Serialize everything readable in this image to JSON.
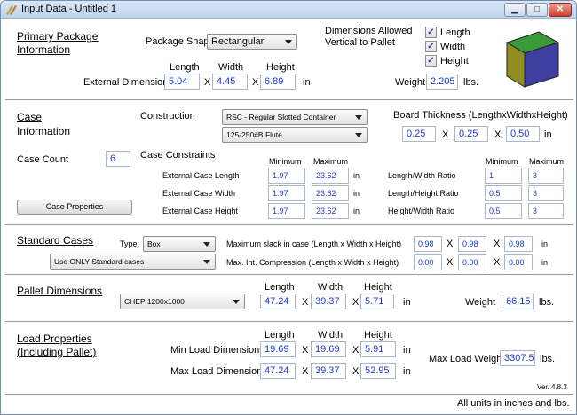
{
  "window": {
    "title": "Input Data - Untitled 1",
    "controls": {
      "minimize": "▁",
      "maximize": "□",
      "close": "✕"
    }
  },
  "primary": {
    "title_line1": "Primary Package",
    "title_line2": "Information",
    "shape_label": "Package Shape",
    "shape_value": "Rectangular",
    "dims_allowed_line1": "Dimensions Allowed",
    "dims_allowed_line2": "Vertical to Pallet",
    "checkboxes": [
      {
        "label": "Length",
        "checked": true
      },
      {
        "label": "Width",
        "checked": true
      },
      {
        "label": "Height",
        "checked": true
      }
    ],
    "col_length": "Length",
    "col_width": "Width",
    "col_height": "Height",
    "ext_label": "External Dimensions",
    "length": "5.04",
    "width": "4.45",
    "height": "6.89",
    "unit_in": "in",
    "weight_label": "Weight",
    "weight": "2.205",
    "weight_unit": "lbs.",
    "x": "X",
    "box_colors": {
      "top": "#3a9a3a",
      "left": "#8e8e22",
      "front": "#3f3f9f"
    }
  },
  "case": {
    "title_line1": "Case",
    "title_line2": "Information",
    "construction_label": "Construction",
    "construction_value": "RSC - Regular Slotted Container",
    "flute_value": "125-250#B Flute",
    "board_label": "Board Thickness (LengthxWidthxHeight)",
    "board_length": "0.25",
    "board_width": "0.25",
    "board_height": "0.50",
    "unit_in": "in",
    "count_label": "Case Count",
    "count": "6",
    "constraints_label": "Case Constraints",
    "col_min": "Minimum",
    "col_max": "Maximum",
    "rows": [
      {
        "label": "External Case Length",
        "min": "1.97",
        "max": "23.62",
        "unit": "in"
      },
      {
        "label": "External Case Width",
        "min": "1.97",
        "max": "23.62",
        "unit": "in"
      },
      {
        "label": "External Case Height",
        "min": "1.97",
        "max": "23.62",
        "unit": "in"
      }
    ],
    "ratio_rows": [
      {
        "label": "Length/Width Ratio",
        "min": "1",
        "max": "3"
      },
      {
        "label": "Length/Height Ratio",
        "min": "0.5",
        "max": "3"
      },
      {
        "label": "Height/Width Ratio",
        "min": "0.5",
        "max": "3"
      }
    ],
    "properties_button": "Case Properties",
    "x": "X"
  },
  "standard": {
    "title": "Standard Cases",
    "type_label": "Type:",
    "type_value": "Box",
    "mode_value": "Use ONLY Standard cases",
    "slack_label": "Maximum slack in case  (Length x Width x Height)",
    "compression_label": "Max. Int. Compression (Length x Width x Height)",
    "slack_l": "0.98",
    "slack_w": "0.98",
    "slack_h": "0.98",
    "comp_l": "0.00",
    "comp_w": "0.00",
    "comp_h": "0.00",
    "unit_in": "in",
    "x": "X"
  },
  "pallet": {
    "title": "Pallet Dimensions",
    "type_value": "CHEP 1200x1000",
    "col_length": "Length",
    "col_width": "Width",
    "col_height": "Height",
    "length": "47.24",
    "width": "39.37",
    "height": "5.71",
    "unit_in": "in",
    "weight_label": "Weight",
    "weight": "66.15",
    "weight_unit": "lbs.",
    "x": "X"
  },
  "load": {
    "title_line1": "Load Properties",
    "title_line2": "(Including Pallet)",
    "col_length": "Length",
    "col_width": "Width",
    "col_height": "Height",
    "min_label": "Min Load Dimensions",
    "min_l": "19.69",
    "min_w": "19.69",
    "min_h": "5.91",
    "max_label": "Max Load Dimensions",
    "max_l": "47.24",
    "max_w": "39.37",
    "max_h": "52.95",
    "unit_in": "in",
    "max_weight_label": "Max Load Weight",
    "max_weight": "3307.5",
    "weight_unit": "lbs.",
    "version": "Ver. 4.8.3",
    "x": "X"
  },
  "status": {
    "units_note": "All units in inches and lbs."
  }
}
